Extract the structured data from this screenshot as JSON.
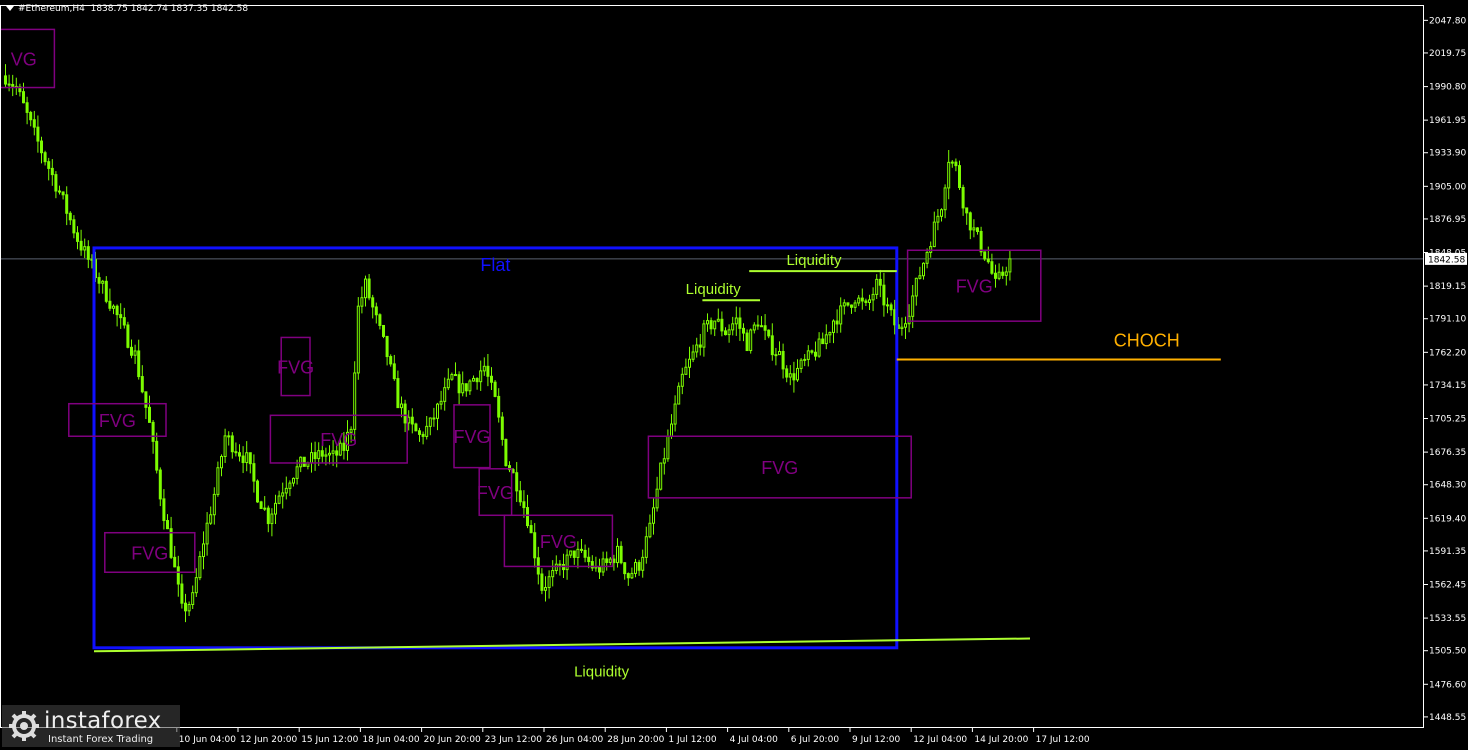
{
  "header": {
    "symbol": "#Ethereum,H4",
    "ohlc": "1838.75 1842.74 1837.35 1842.58"
  },
  "logo": {
    "name": "instaforex",
    "tagline": "Instant Forex Trading"
  },
  "colors": {
    "background": "#000000",
    "candles": "#7cfc00",
    "fvg_box": "#800080",
    "flat_box": "#1010ff",
    "liquidity": "#adff2f",
    "choch": "#ffb000",
    "axis_text": "#ffffff",
    "price_line": "#5a6270"
  },
  "chart_data": {
    "type": "candlestick",
    "symbol": "#Ethereum",
    "timeframe": "H4",
    "ylim": [
      1439.0,
      2061.0
    ],
    "y_ticks": [
      "2047.80",
      "2019.75",
      "1990.80",
      "1961.95",
      "1933.90",
      "1905.00",
      "1876.95",
      "1848.05",
      "1819.15",
      "1791.10",
      "1762.20",
      "1734.15",
      "1705.25",
      "1676.35",
      "1648.30",
      "1619.40",
      "1591.35",
      "1562.45",
      "1533.55",
      "1505.50",
      "1476.60",
      "1448.55"
    ],
    "current_price": "1842.58",
    "x_ticks": [
      "10 Jun 04:00",
      "12 Jun 20:00",
      "15 Jun 12:00",
      "18 Jun 04:00",
      "20 Jun 20:00",
      "23 Jun 12:00",
      "26 Jun 04:00",
      "28 Jun 20:00",
      "1 Jul 12:00",
      "4 Jul 04:00",
      "6 Jul 20:00",
      "9 Jul 12:00",
      "12 Jul 04:00",
      "14 Jul 20:00",
      "17 Jul 12:00"
    ],
    "price_path": [
      [
        0,
        2000
      ],
      [
        3,
        1990
      ],
      [
        8,
        1950
      ],
      [
        15,
        1900
      ],
      [
        20,
        1860
      ],
      [
        25,
        1830
      ],
      [
        30,
        1800
      ],
      [
        36,
        1760
      ],
      [
        40,
        1700
      ],
      [
        43,
        1640
      ],
      [
        47,
        1575
      ],
      [
        49,
        1540
      ],
      [
        52,
        1550
      ],
      [
        55,
        1600
      ],
      [
        58,
        1640
      ],
      [
        61,
        1690
      ],
      [
        64,
        1680
      ],
      [
        67,
        1670
      ],
      [
        70,
        1640
      ],
      [
        73,
        1620
      ],
      [
        76,
        1640
      ],
      [
        79,
        1655
      ],
      [
        82,
        1665
      ],
      [
        85,
        1670
      ],
      [
        88,
        1675
      ],
      [
        91,
        1672
      ],
      [
        94,
        1680
      ],
      [
        96,
        1700
      ],
      [
        98,
        1800
      ],
      [
        100,
        1820
      ],
      [
        103,
        1790
      ],
      [
        106,
        1760
      ],
      [
        109,
        1720
      ],
      [
        112,
        1700
      ],
      [
        115,
        1690
      ],
      [
        118,
        1700
      ],
      [
        121,
        1720
      ],
      [
        124,
        1740
      ],
      [
        127,
        1730
      ],
      [
        130,
        1740
      ],
      [
        133,
        1750
      ],
      [
        136,
        1720
      ],
      [
        139,
        1670
      ],
      [
        142,
        1650
      ],
      [
        145,
        1620
      ],
      [
        147,
        1590
      ],
      [
        149,
        1560
      ],
      [
        152,
        1570
      ],
      [
        155,
        1580
      ],
      [
        158,
        1590
      ],
      [
        161,
        1585
      ],
      [
        164,
        1575
      ],
      [
        167,
        1580
      ],
      [
        170,
        1590
      ],
      [
        173,
        1570
      ],
      [
        176,
        1580
      ],
      [
        179,
        1610
      ],
      [
        182,
        1660
      ],
      [
        185,
        1700
      ],
      [
        188,
        1740
      ],
      [
        191,
        1760
      ],
      [
        194,
        1780
      ],
      [
        197,
        1790
      ],
      [
        200,
        1780
      ],
      [
        203,
        1790
      ],
      [
        206,
        1770
      ],
      [
        209,
        1790
      ],
      [
        212,
        1770
      ],
      [
        215,
        1760
      ],
      [
        218,
        1740
      ],
      [
        221,
        1750
      ],
      [
        224,
        1760
      ],
      [
        227,
        1770
      ],
      [
        230,
        1790
      ],
      [
        233,
        1800
      ],
      [
        236,
        1810
      ],
      [
        239,
        1800
      ],
      [
        242,
        1820
      ],
      [
        245,
        1800
      ],
      [
        248,
        1780
      ],
      [
        251,
        1800
      ],
      [
        254,
        1830
      ],
      [
        257,
        1860
      ],
      [
        260,
        1890
      ],
      [
        262,
        1930
      ],
      [
        264,
        1920
      ],
      [
        267,
        1880
      ],
      [
        270,
        1860
      ],
      [
        273,
        1840
      ],
      [
        275,
        1820
      ],
      [
        277,
        1830
      ],
      [
        279,
        1842.58
      ]
    ],
    "annotations": {
      "fvg_label": "FVG",
      "fvg_label_clipped": "VG",
      "flat_label": "Flat",
      "liquidity_label": "Liquidity",
      "choch_label": "CHOCH",
      "fvg_zones": [
        {
          "bar_from": -3,
          "bar_to": 14,
          "price_low": 1990,
          "price_high": 2040,
          "clipped": true
        },
        {
          "bar_from": 18,
          "bar_to": 45,
          "price_low": 1690,
          "price_high": 1718
        },
        {
          "bar_from": 28,
          "bar_to": 53,
          "price_low": 1573,
          "price_high": 1607
        },
        {
          "bar_from": 77,
          "bar_to": 85,
          "price_low": 1725,
          "price_high": 1775
        },
        {
          "bar_from": 74,
          "bar_to": 112,
          "price_low": 1667,
          "price_high": 1708
        },
        {
          "bar_from": 125,
          "bar_to": 135,
          "price_low": 1663,
          "price_high": 1717
        },
        {
          "bar_from": 132,
          "bar_to": 141,
          "price_low": 1622,
          "price_high": 1662
        },
        {
          "bar_from": 139,
          "bar_to": 169,
          "price_low": 1578,
          "price_high": 1622
        },
        {
          "bar_from": 179,
          "bar_to": 252,
          "price_low": 1637,
          "price_high": 1690
        },
        {
          "bar_from": 251,
          "bar_to": 288,
          "price_low": 1789,
          "price_high": 1850
        }
      ],
      "flat_zone": {
        "bar_from": 25,
        "bar_to": 248,
        "price_low": 1508,
        "price_high": 1852
      },
      "liquidity_levels": [
        {
          "bar_from": 25,
          "bar_to": 285,
          "price_from": 1505,
          "price_to": 1516,
          "label_bar": 166,
          "label_above": false
        },
        {
          "bar_from": 194,
          "bar_to": 210,
          "price_from": 1807,
          "price_to": 1807,
          "label_bar": 197,
          "label_above": true
        },
        {
          "bar_from": 207,
          "bar_to": 248,
          "price_from": 1832,
          "price_to": 1832,
          "label_bar": 225,
          "label_above": true
        }
      ],
      "choch_level": {
        "bar_from": 248,
        "bar_to": 338,
        "price": 1756
      }
    }
  }
}
